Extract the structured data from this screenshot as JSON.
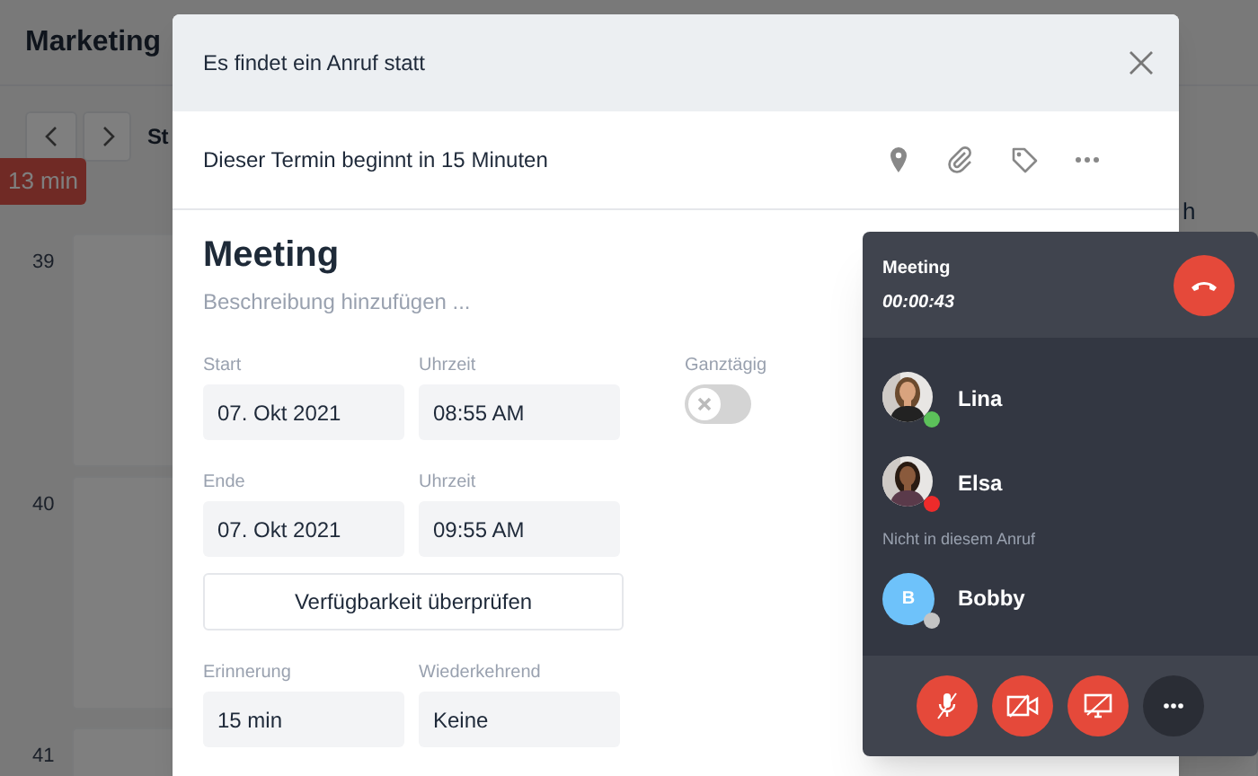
{
  "background": {
    "title": "Marketing",
    "view_label": "St",
    "now_badge": "13 min",
    "week_numbers": [
      "39",
      "40",
      "41"
    ],
    "cut_text": "h"
  },
  "dialog": {
    "title": "Es findet ein Anruf statt",
    "notice": "Dieser Termin beginnt in 15 Minuten",
    "event_title": "Meeting",
    "description": {
      "placeholder": "Beschreibung hinzufügen ..."
    },
    "date_fields": [
      {
        "label": "Start",
        "value": "07. Okt 2021"
      },
      {
        "label": "Uhrzeit",
        "value": "08:55 AM"
      },
      {
        "label": "Ende",
        "value": "07. Okt 2021"
      },
      {
        "label": "Uhrzeit",
        "value": "09:55 AM"
      }
    ],
    "all_day": {
      "label": "Ganztägig",
      "on": false
    },
    "check_button": "Verfügbarkeit überprüfen",
    "extra_fields": [
      {
        "label": "Erinnerung",
        "value": "15 min"
      },
      {
        "label": "Wiederkehrend",
        "value": "Keine"
      }
    ]
  },
  "call": {
    "title": "Meeting",
    "duration": "00:00:43",
    "participants": [
      {
        "name": "Lina",
        "color": "#5cc15a"
      },
      {
        "name": "Elsa",
        "color": "#ee2b2b"
      }
    ],
    "absent_label": "Nicht in diesem Anruf",
    "absent": [
      {
        "name": "Bobby",
        "color": "#c4c4c4",
        "avatar": {
          "kind": "initial",
          "initial": "B"
        }
      }
    ],
    "controls": [
      {
        "kind": "mic",
        "on": false
      },
      {
        "kind": "camera",
        "on": false
      },
      {
        "kind": "screen",
        "on": false
      },
      {
        "kind": "more"
      }
    ]
  }
}
